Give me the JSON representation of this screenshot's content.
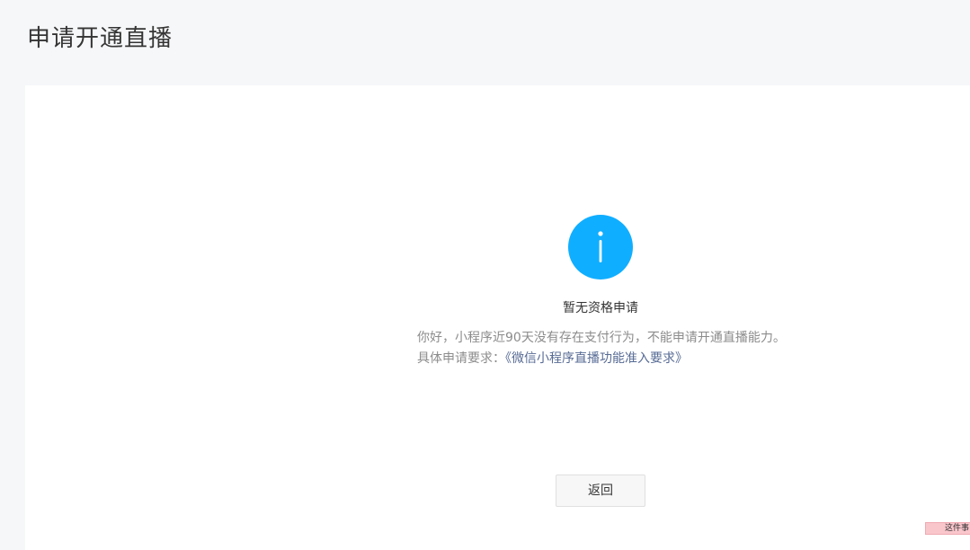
{
  "page": {
    "title": "申请开通直播"
  },
  "message": {
    "icon": "info-icon",
    "icon_color": "#10aeff",
    "title": "暂无资格申请",
    "description": "你好，小程序近90天没有存在支付行为，不能申请开通直播能力。",
    "requirement_label": "具体申请要求：",
    "requirement_link": "《微信小程序直播功能准入要求》",
    "link_color": "#576b95"
  },
  "actions": {
    "back_label": "返回"
  },
  "floating_tag": {
    "text": "这件事"
  }
}
